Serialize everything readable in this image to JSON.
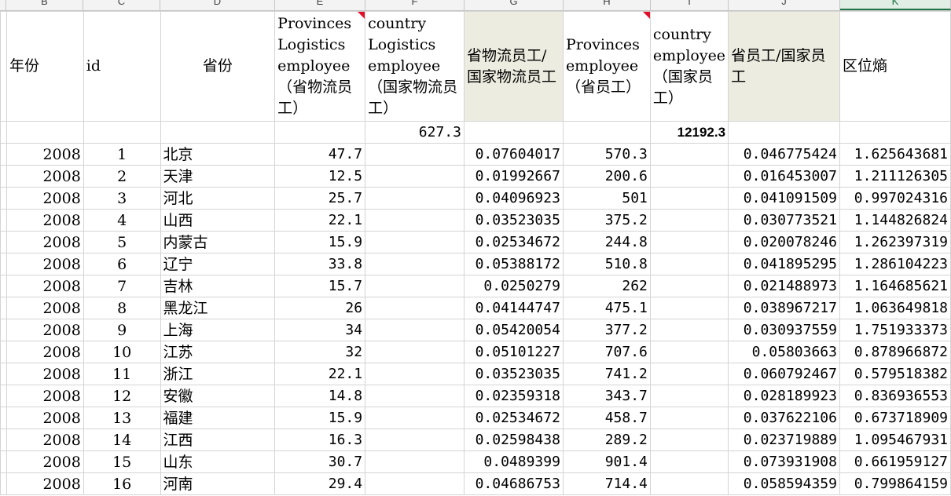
{
  "column_letters": [
    "B",
    "C",
    "D",
    "E",
    "F",
    "G",
    "H",
    "I",
    "J",
    "K"
  ],
  "headers": {
    "year": "年份",
    "id": "id",
    "province": "省份",
    "prov_log_emp": "Provinces Logistics employee （省物流员工）",
    "country_log_emp": "country Logistics employee （国家物流员工）",
    "ratio_log": "省物流员工/国家物流员工",
    "prov_emp": "Provinces employee （省员工）",
    "country_emp": "country employee （国家员工）",
    "ratio_emp": "省员工/国家员工",
    "entropy": "区位熵"
  },
  "totals": {
    "country_log_emp": "627.3",
    "country_emp": "12192.3"
  },
  "rows": [
    {
      "year": "2008",
      "id": "1",
      "province": "北京",
      "prov_log_emp": "47.7",
      "ratio_log": "0.07604017",
      "prov_emp": "570.3",
      "ratio_emp": "0.046775424",
      "entropy": "1.625643681"
    },
    {
      "year": "2008",
      "id": "2",
      "province": "天津",
      "prov_log_emp": "12.5",
      "ratio_log": "0.01992667",
      "prov_emp": "200.6",
      "ratio_emp": "0.016453007",
      "entropy": "1.211126305"
    },
    {
      "year": "2008",
      "id": "3",
      "province": "河北",
      "prov_log_emp": "25.7",
      "ratio_log": "0.04096923",
      "prov_emp": "501",
      "ratio_emp": "0.041091509",
      "entropy": "0.997024316"
    },
    {
      "year": "2008",
      "id": "4",
      "province": "山西",
      "prov_log_emp": "22.1",
      "ratio_log": "0.03523035",
      "prov_emp": "375.2",
      "ratio_emp": "0.030773521",
      "entropy": "1.144826824"
    },
    {
      "year": "2008",
      "id": "5",
      "province": "内蒙古",
      "prov_log_emp": "15.9",
      "ratio_log": "0.02534672",
      "prov_emp": "244.8",
      "ratio_emp": "0.020078246",
      "entropy": "1.262397319"
    },
    {
      "year": "2008",
      "id": "6",
      "province": "辽宁",
      "prov_log_emp": "33.8",
      "ratio_log": "0.05388172",
      "prov_emp": "510.8",
      "ratio_emp": "0.041895295",
      "entropy": "1.286104223"
    },
    {
      "year": "2008",
      "id": "7",
      "province": "吉林",
      "prov_log_emp": "15.7",
      "ratio_log": "0.0250279",
      "prov_emp": "262",
      "ratio_emp": "0.021488973",
      "entropy": "1.164685621"
    },
    {
      "year": "2008",
      "id": "8",
      "province": "黑龙江",
      "prov_log_emp": "26",
      "ratio_log": "0.04144747",
      "prov_emp": "475.1",
      "ratio_emp": "0.038967217",
      "entropy": "1.063649818"
    },
    {
      "year": "2008",
      "id": "9",
      "province": "上海",
      "prov_log_emp": "34",
      "ratio_log": "0.05420054",
      "prov_emp": "377.2",
      "ratio_emp": "0.030937559",
      "entropy": "1.751933373"
    },
    {
      "year": "2008",
      "id": "10",
      "province": "江苏",
      "prov_log_emp": "32",
      "ratio_log": "0.05101227",
      "prov_emp": "707.6",
      "ratio_emp": "0.05803663",
      "entropy": "0.878966872"
    },
    {
      "year": "2008",
      "id": "11",
      "province": "浙江",
      "prov_log_emp": "22.1",
      "ratio_log": "0.03523035",
      "prov_emp": "741.2",
      "ratio_emp": "0.060792467",
      "entropy": "0.579518382"
    },
    {
      "year": "2008",
      "id": "12",
      "province": "安徽",
      "prov_log_emp": "14.8",
      "ratio_log": "0.02359318",
      "prov_emp": "343.7",
      "ratio_emp": "0.028189923",
      "entropy": "0.836936553"
    },
    {
      "year": "2008",
      "id": "13",
      "province": "福建",
      "prov_log_emp": "15.9",
      "ratio_log": "0.02534672",
      "prov_emp": "458.7",
      "ratio_emp": "0.037622106",
      "entropy": "0.673718909"
    },
    {
      "year": "2008",
      "id": "14",
      "province": "江西",
      "prov_log_emp": "16.3",
      "ratio_log": "0.02598438",
      "prov_emp": "289.2",
      "ratio_emp": "0.023719889",
      "entropy": "1.095467931"
    },
    {
      "year": "2008",
      "id": "15",
      "province": "山东",
      "prov_log_emp": "30.7",
      "ratio_log": "0.0489399",
      "prov_emp": "901.4",
      "ratio_emp": "0.073931908",
      "entropy": "0.661959127"
    },
    {
      "year": "2008",
      "id": "16",
      "province": "河南",
      "prov_log_emp": "29.4",
      "ratio_log": "0.04686753",
      "prov_emp": "714.4",
      "ratio_emp": "0.058594359",
      "entropy": "0.799864159"
    }
  ],
  "colors": {
    "header_shade": "#ecece0",
    "comment_marker": "#e0102a",
    "active_column": "#217346"
  }
}
